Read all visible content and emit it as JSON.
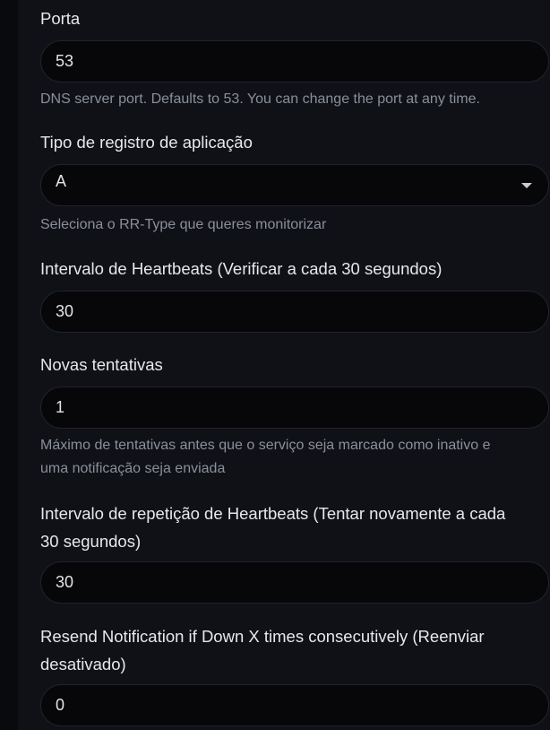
{
  "fields": {
    "porta": {
      "label": "Porta",
      "value": "53",
      "hint": "DNS server port. Defaults to 53. You can change the port at any time."
    },
    "rr_type": {
      "label": "Tipo de registro de aplicação",
      "value": "A",
      "hint": "Seleciona o RR-Type que queres monitorizar"
    },
    "heartbeat_interval": {
      "label": "Intervalo de Heartbeats (Verificar a cada 30 segundos)",
      "value": "30"
    },
    "retries": {
      "label": "Novas tentativas",
      "value": "1",
      "hint_line1": "Máximo de tentativas antes que o serviço seja marcado como inativo e",
      "hint_line2": "uma notificação seja enviada"
    },
    "retry_interval": {
      "label_line1": "Intervalo de repetição de Heartbeats (Tentar novamente a cada",
      "label_line2": "30 segundos)",
      "value": "30"
    },
    "resend": {
      "label_line1": "Resend Notification if Down X times consecutively (Reenviar",
      "label_line2": "desativado)",
      "value": "0"
    }
  },
  "icons": {
    "dropdown": "chevron-down-icon"
  },
  "colors": {
    "background": "#0f1117",
    "input_bg": "#070709",
    "text": "#e6e8ec",
    "hint": "#8a8f99"
  }
}
